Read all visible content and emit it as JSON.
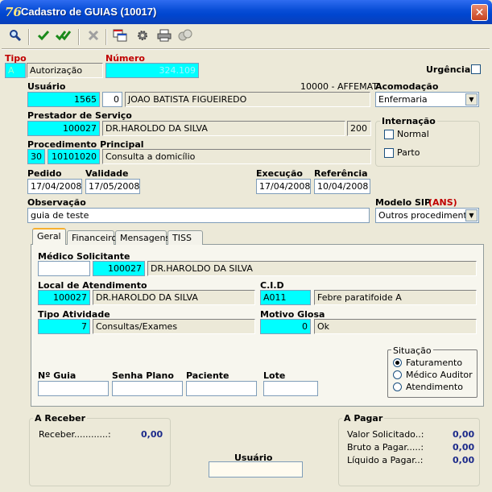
{
  "window": {
    "title": "Cadastro de GUIAS (10017)",
    "close_glyph": "✕",
    "app_glyph": "76"
  },
  "toolbar": {
    "icons": [
      "search-icon",
      "check-icon",
      "double-check-icon",
      "delete-icon",
      "window-icon",
      "gear-icon",
      "printer-icon",
      "coins-icon"
    ]
  },
  "header": {
    "tipo_label": "Tipo",
    "tipo_code": "A",
    "tipo_value": "Autorização",
    "numero_label": "Número",
    "numero_value": "324.109",
    "urgencia_label": "Urgência"
  },
  "usuario": {
    "label": "Usuário",
    "info": "10000 - AFFEMAT",
    "code": "1565",
    "digit": "0",
    "name": "JOAO BATISTA FIGUEIREDO"
  },
  "acomodacao": {
    "label": "Acomodação",
    "value": "Enfermaria"
  },
  "prestador": {
    "label": "Prestador de Serviço",
    "code": "100027",
    "name": "DR.HAROLDO DA SILVA",
    "extra": "200"
  },
  "internacao": {
    "title": "Internação",
    "normal": "Normal",
    "parto": "Parto"
  },
  "procedimento": {
    "label": "Procedimento Principal",
    "qty": "30",
    "code": "10101020",
    "name": "Consulta a domicílio"
  },
  "datas": {
    "pedido_label": "Pedido",
    "pedido": "17/04/2008",
    "validade_label": "Validade",
    "validade": "17/05/2008",
    "execucao_label": "Execução",
    "execucao": "17/04/2008",
    "referencia_label": "Referência",
    "referencia": "10/04/2008"
  },
  "observacao": {
    "label": "Observação",
    "value": "guia de teste"
  },
  "modelo_sip": {
    "label": "Modelo SIP",
    "tag": "(ANS)",
    "value": "Outros procedimentos"
  },
  "tabs": [
    {
      "label": "Geral"
    },
    {
      "label": "Financeiro"
    },
    {
      "label": "Mensagens"
    },
    {
      "label": "TISS"
    }
  ],
  "geral": {
    "medico_label": "Médico Solicitante",
    "medico_code": "100027",
    "medico_name": "DR.HAROLDO DA SILVA",
    "local_label": "Local de Atendimento",
    "local_code": "100027",
    "local_name": "DR.HAROLDO DA SILVA",
    "cid_label": "C.I.D",
    "cid_code": "A011",
    "cid_name": "Febre paratifoide A",
    "tipo_atividade_label": "Tipo Atividade",
    "tipo_atividade_code": "7",
    "tipo_atividade_name": "Consultas/Exames",
    "motivo_glosa_label": "Motivo Glosa",
    "motivo_glosa_code": "0",
    "motivo_glosa_name": "Ok",
    "n_guia_label": "Nº Guia",
    "senha_plano_label": "Senha Plano",
    "paciente_label": "Paciente",
    "lote_label": "Lote",
    "situacao_title": "Situação",
    "situacao_options": [
      "Faturamento",
      "Médico Auditor",
      "Atendimento"
    ]
  },
  "a_receber": {
    "title": "A Receber",
    "receber_label": "Receber............:",
    "receber_value": "0,00"
  },
  "usuario_footer": {
    "label": "Usuário"
  },
  "a_pagar": {
    "title": "A Pagar",
    "valor_solicitado_label": "Valor Solicitado..:",
    "valor_solicitado": "0,00",
    "bruto_label": "Bruto a Pagar.....:",
    "bruto": "0,00",
    "liquido_label": "Líquido a Pagar..:",
    "liquido": "0,00"
  },
  "colors": {
    "cyan": "#00ffff",
    "label_red": "#c00000",
    "value_blue": "#1c2a8a",
    "title_blue": "#0046d0"
  }
}
